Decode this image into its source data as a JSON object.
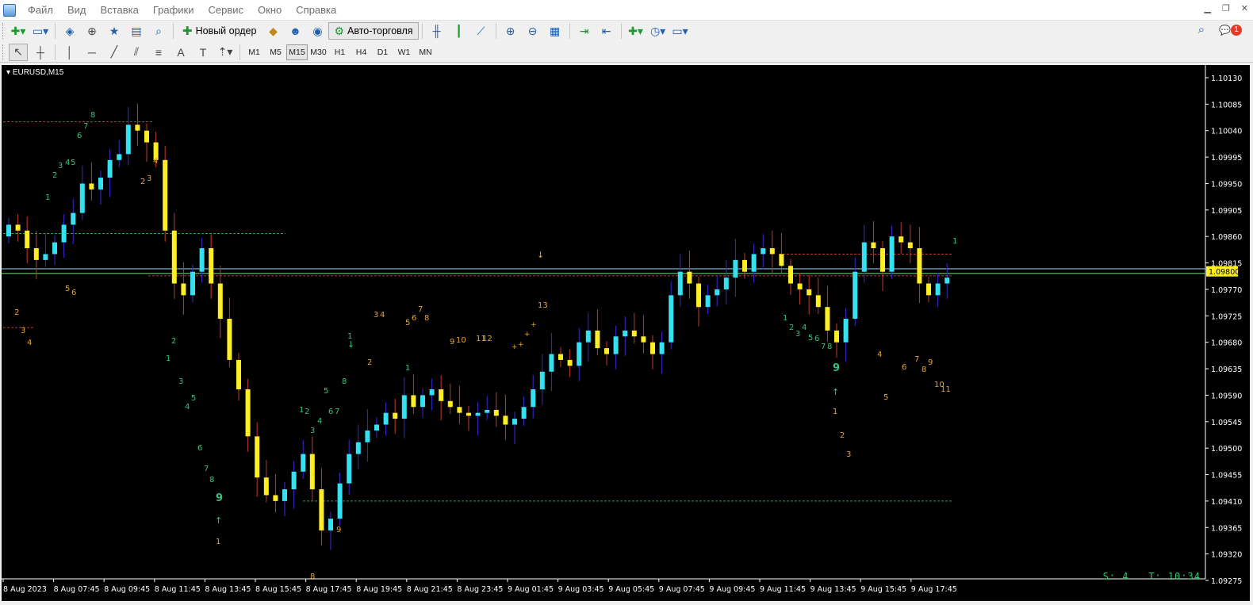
{
  "menu": {
    "items": [
      "Файл",
      "Вид",
      "Вставка",
      "Графики",
      "Сервис",
      "Окно",
      "Справка"
    ]
  },
  "toolbar": {
    "new_order_label": "Новый ордер",
    "autotrading_label": "Авто-торговля",
    "notification_count": "1"
  },
  "timeframes": {
    "items": [
      "M1",
      "M5",
      "M15",
      "M30",
      "H1",
      "H4",
      "D1",
      "W1",
      "MN"
    ],
    "active": "M15"
  },
  "chart": {
    "symbol_label": "EURUSD,M15",
    "current_price": "1.09800",
    "status_text": "S: 4.. T: 10:34",
    "price_ticks": [
      "1.10130",
      "1.10085",
      "1.10040",
      "1.09995",
      "1.09950",
      "1.09905",
      "1.09860",
      "1.09815",
      "1.09770",
      "1.09725",
      "1.09680",
      "1.09635",
      "1.09590",
      "1.09545",
      "1.09500",
      "1.09455",
      "1.09410",
      "1.09365",
      "1.09320",
      "1.09275"
    ],
    "time_ticks": [
      "8 Aug 2023",
      "8 Aug 07:45",
      "8 Aug 09:45",
      "8 Aug 11:45",
      "8 Aug 13:45",
      "8 Aug 15:45",
      "8 Aug 17:45",
      "8 Aug 19:45",
      "8 Aug 21:45",
      "8 Aug 23:45",
      "9 Aug 01:45",
      "9 Aug 03:45",
      "9 Aug 05:45",
      "9 Aug 07:45",
      "9 Aug 09:45",
      "9 Aug 11:45",
      "9 Aug 13:45",
      "9 Aug 15:45",
      "9 Aug 17:45"
    ],
    "colors": {
      "bull": "#33e1f0",
      "bear": "#ffee22",
      "wick_up": "#3a2bd6",
      "wick_down": "#c0392b",
      "grid": "#000000",
      "label_green": "#34c47c",
      "label_orange": "#e3a52b",
      "price_line": "#9fd6ff"
    }
  }
}
